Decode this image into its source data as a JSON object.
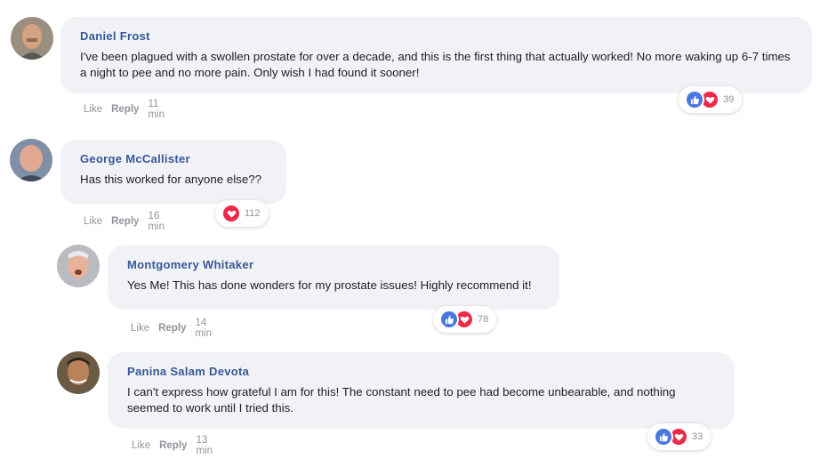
{
  "comments": [
    {
      "name": "Daniel Frost",
      "text": "I've been plagued with a swollen prostate for over a decade, and this is the first thing that actually worked! No more waking up 6-7 times a night to pee and no more pain. Only wish I had found it sooner!",
      "like_label": "Like",
      "reply_label": "Reply",
      "time": "11 min",
      "reactions": [
        "like",
        "love"
      ],
      "reaction_count": "39"
    },
    {
      "name": "George McCallister",
      "text": "Has this worked for anyone else??",
      "like_label": "Like",
      "reply_label": "Reply",
      "time": "16 min",
      "reactions": [
        "love"
      ],
      "reaction_count": "112"
    },
    {
      "name": "Montgomery Whitaker",
      "text": "Yes Me! This has done wonders for my prostate issues! Highly recommend it!",
      "like_label": "Like",
      "reply_label": "Reply",
      "time": "14 min",
      "reactions": [
        "like",
        "love"
      ],
      "reaction_count": "78"
    },
    {
      "name": "Panina Salam Devota",
      "text": "I can't express how grateful I am for this! The constant need to pee had become unbearable, and nothing seemed to work until I tried this.",
      "like_label": "Like",
      "reply_label": "Reply",
      "time": "13 min",
      "reactions": [
        "like",
        "love"
      ],
      "reaction_count": "33"
    }
  ],
  "colors": {
    "name": "#385898",
    "bubble": "#f0f2f5",
    "like_reaction": "#4a76e0",
    "love_reaction": "#f0284a",
    "meta": "#90949c"
  }
}
